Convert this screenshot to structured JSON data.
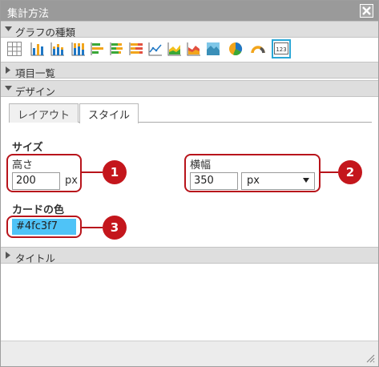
{
  "window": {
    "title": "集計方法"
  },
  "sections": {
    "graph_type": "グラフの種類",
    "items": "項目一覧",
    "design": "デザイン",
    "title": "タイトル"
  },
  "chart_types": [
    "table-icon",
    "bar-chart-icon",
    "stacked-bar-chart-icon",
    "percent-bar-chart-icon",
    "horizontal-bar-chart-icon",
    "stacked-horizontal-bar-chart-icon",
    "percent-horizontal-bar-chart-icon",
    "line-chart-icon",
    "area-chart-icon",
    "stacked-area-chart-icon",
    "percent-area-chart-icon",
    "pie-chart-icon",
    "gauge-chart-icon",
    "number-card-icon"
  ],
  "number_card_icon_text": "123",
  "tabs": [
    {
      "label": "レイアウト",
      "active": false
    },
    {
      "label": "スタイル",
      "active": true
    }
  ],
  "size": {
    "heading": "サイズ",
    "height_label": "高さ",
    "height_value": "200",
    "height_unit": "px",
    "width_label": "横幅",
    "width_value": "350",
    "width_unit": "px"
  },
  "card_color": {
    "label": "カードの色",
    "value": "#4fc3f7"
  },
  "callouts": [
    "1",
    "2",
    "3"
  ],
  "colors": {
    "accent_selected": "#2aa7d6",
    "callout_red": "#c4161c",
    "titlebar": "#9a9a9a"
  }
}
